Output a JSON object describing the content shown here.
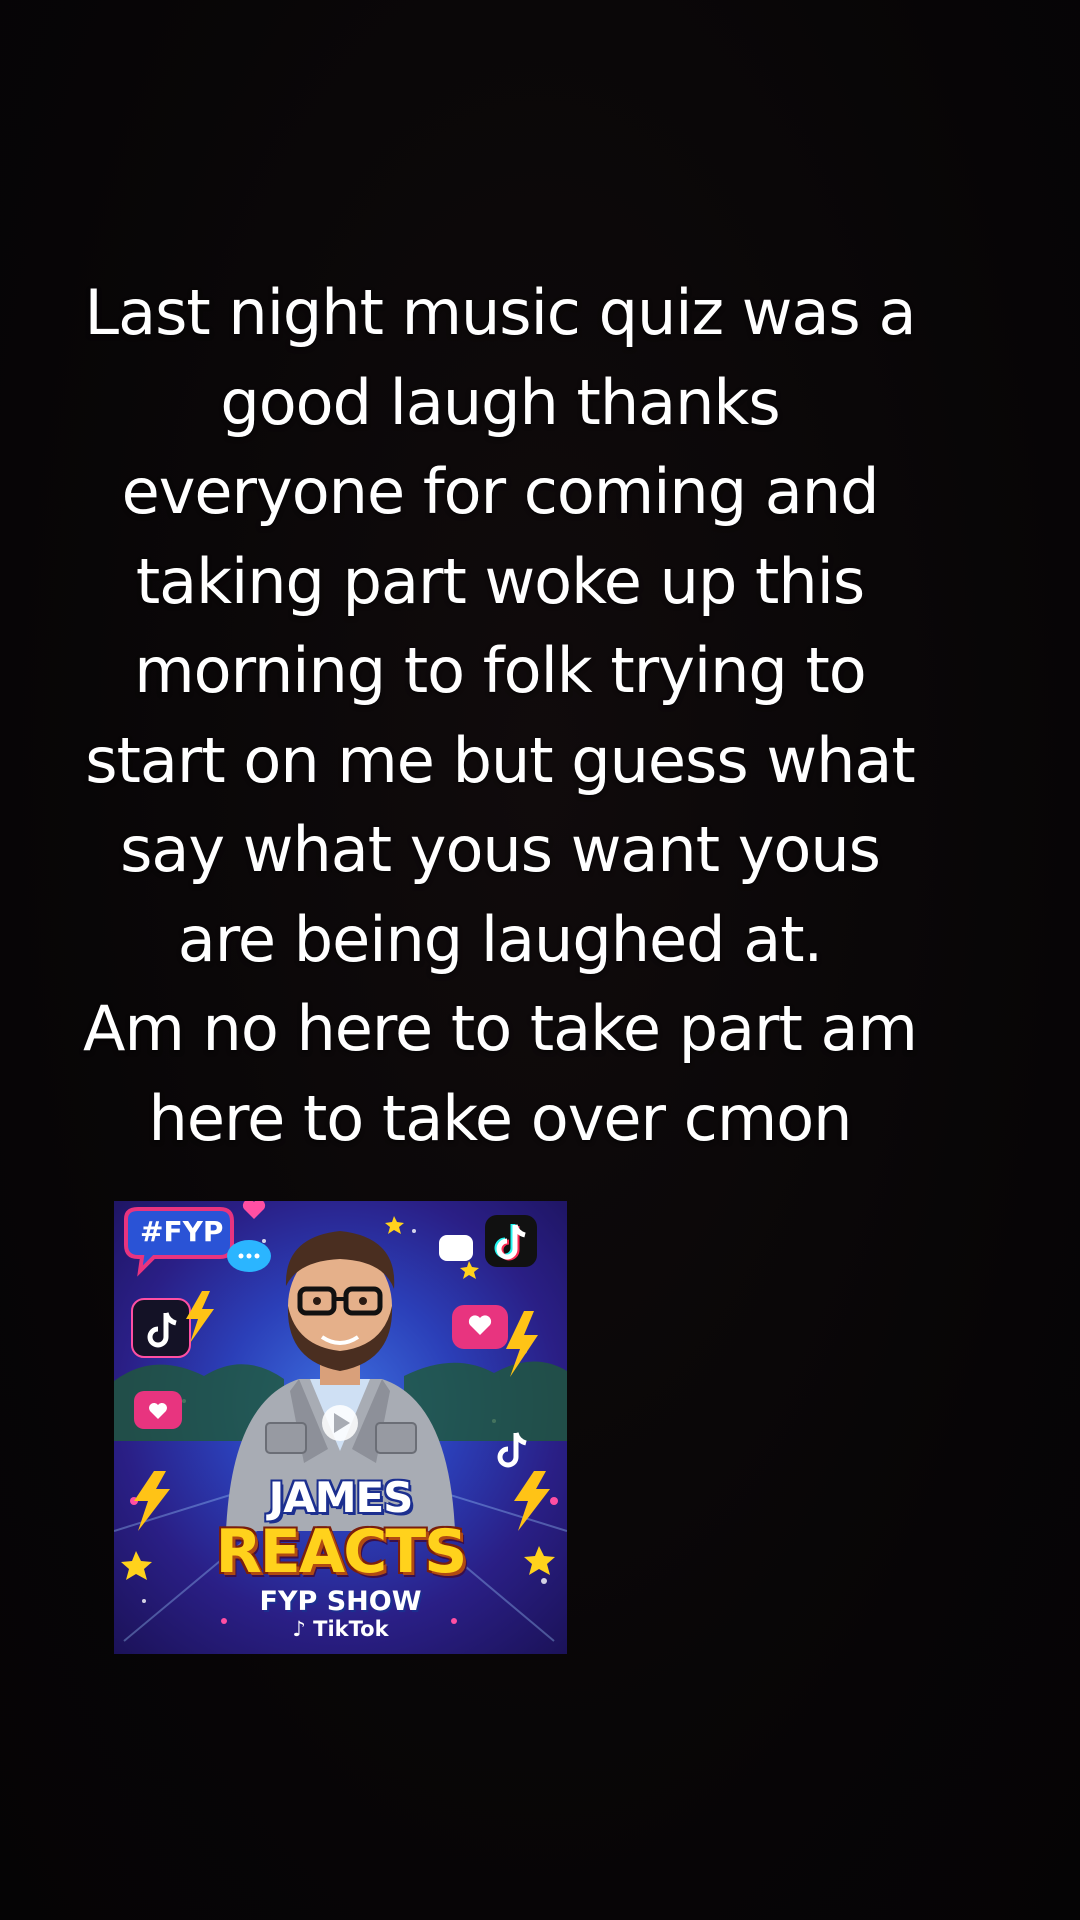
{
  "post": {
    "caption_lines": [
      "Last night music quiz was a",
      "good laugh thanks",
      "everyone for coming and",
      "taking part woke up this",
      "morning to folk trying to",
      "start on me but guess what",
      "say what yous want yous",
      "are being laughed at.",
      "Am no here to take part am",
      "here to take over cmon"
    ],
    "background_color": "#090607",
    "text_color": "#ffffff"
  },
  "thumbnail": {
    "hashtag": "#FYP",
    "name": "JAMES",
    "title": "REACTS",
    "subtitle": "FYP SHOW",
    "brand": "TikTok",
    "brand_icon": "tiktok-note-icon",
    "decor_icons": [
      "tiktok-logo-icon",
      "heart-bubble-icon",
      "lightning-icon",
      "star-icon",
      "chat-bubble-icon"
    ],
    "title_color": "#ffd21c",
    "bg_color": "#2b3fb8"
  }
}
